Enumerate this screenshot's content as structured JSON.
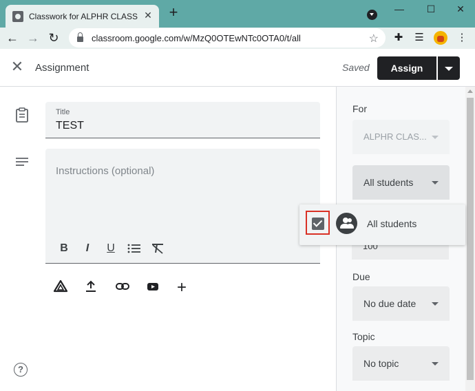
{
  "browser": {
    "tab_title": "Classwork for ALPHR CLASS SAM",
    "tab_close": "✕",
    "new_tab": "+",
    "win_minimize": "—",
    "win_maximize": "☐",
    "win_close": "✕",
    "url": "classroom.google.com/w/MzQ0OTEwNTc0OTA0/t/all",
    "icons": [
      "back-icon",
      "forward-icon",
      "reload-icon",
      "lock-icon",
      "star-icon",
      "extensions-icon",
      "reading-list-icon",
      "profile-avatar",
      "menu-icon"
    ]
  },
  "header": {
    "title": "Assignment",
    "status": "Saved",
    "assign_label": "Assign"
  },
  "editor": {
    "title_label": "Title",
    "title_value": "TEST",
    "instructions_placeholder": "Instructions (optional)",
    "format_buttons": [
      "B",
      "I",
      "U"
    ],
    "attach_icons": [
      "drive-icon",
      "upload-icon",
      "link-icon",
      "youtube-icon",
      "create-icon"
    ]
  },
  "panel": {
    "for_label": "For",
    "class_value": "ALPHR CLAS...",
    "students_value": "All students",
    "points_peek": "100",
    "due_label": "Due",
    "due_value": "No due date",
    "topic_label": "Topic",
    "topic_value": "No topic"
  },
  "popup": {
    "option_label": "All students",
    "checked": true
  },
  "colors": {
    "tabstrip": "#5fa9a6",
    "assign_button": "#202124",
    "highlight": "#d93025"
  }
}
